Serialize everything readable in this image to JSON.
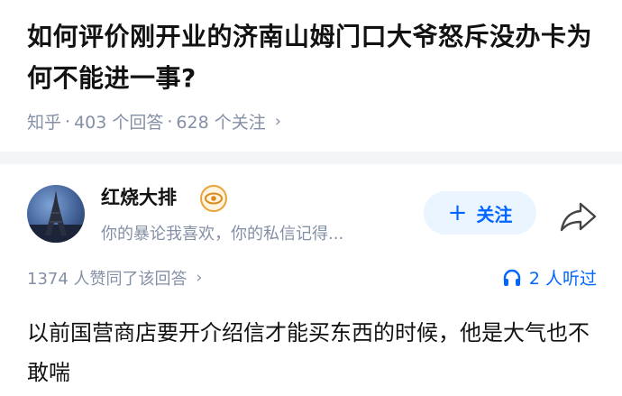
{
  "question": {
    "title": "如何评价刚开业的济南山姆门口大爷怒斥没办卡为何不能进一事?",
    "source": "知乎",
    "separator": "·",
    "answer_count": "403 个回答",
    "follow_count": "628 个关注",
    "chevron": "›"
  },
  "author": {
    "name": "红烧大排",
    "bio": "你的暴论我喜欢，你的私信记得...",
    "badge_icon": "eye-badge-icon",
    "follow_plus": "+",
    "follow_label": "关注"
  },
  "answer": {
    "votes": "1374 人赞同了该回答",
    "chevron": "›",
    "listeners": "2 人听过",
    "content": "以前国营商店要开介绍信才能买东西的时候，他是大气也不敢喘"
  },
  "colors": {
    "accent": "#0066ff",
    "meta": "#8590a6",
    "follow_bg": "#ebf5ff"
  }
}
